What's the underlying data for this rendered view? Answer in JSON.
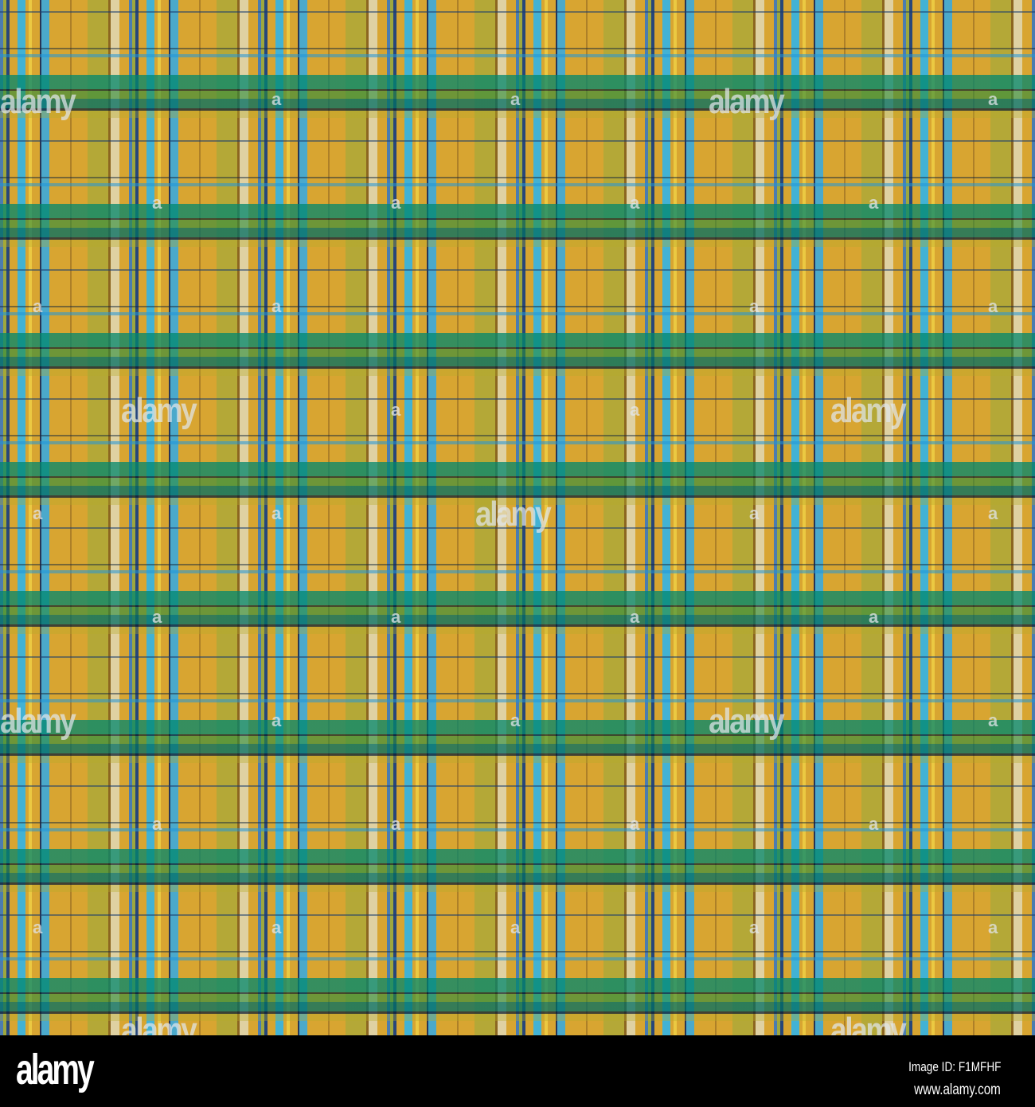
{
  "image": {
    "subject": "plaid-pattern",
    "colors": {
      "gold": "#d8a531",
      "teal": "#00876e",
      "sky_blue": "#32b4e6",
      "navy": "#142a5a",
      "olive": "#96aa3c"
    },
    "watermark_text": "alamy",
    "watermark_small": "a"
  },
  "footer": {
    "logo": "alamy",
    "image_id": "Image ID: F1MFHF",
    "url": "www.alamy.com"
  }
}
